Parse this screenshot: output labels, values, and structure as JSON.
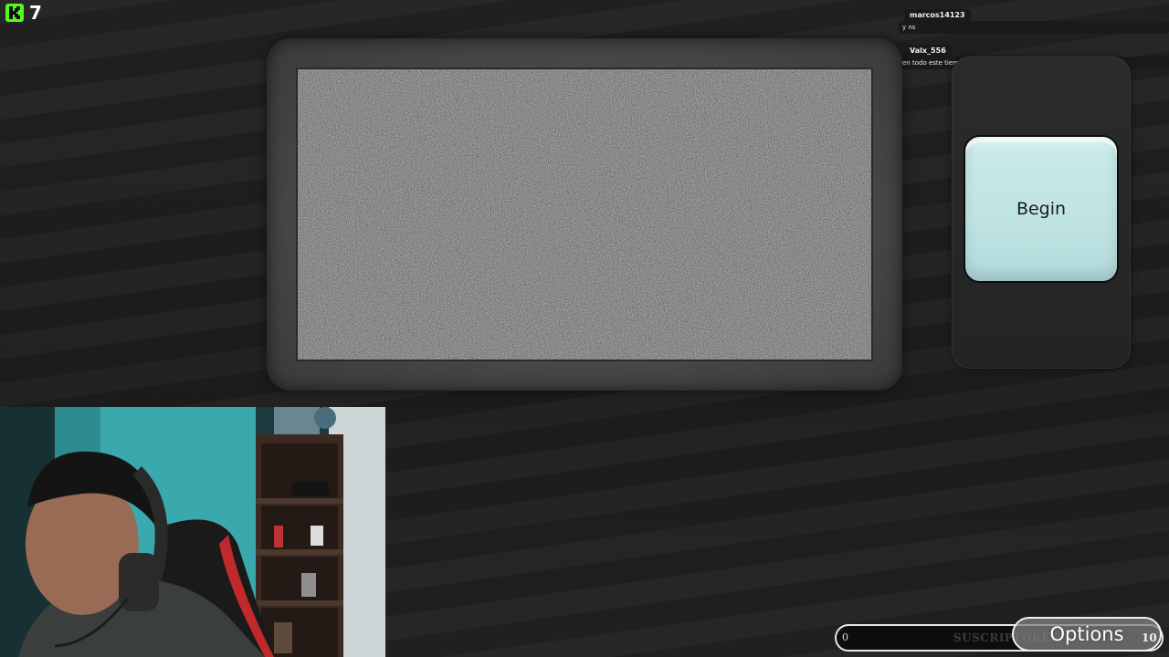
{
  "stream_overlay": {
    "platform_icon": "kick-logo-icon",
    "viewer_count": "7"
  },
  "chat": {
    "messages": [
      {
        "user": "marcos14123",
        "text": "y ns"
      },
      {
        "user": "Valx_556",
        "text": "en todo este tiempo estuve viendo otro steamer"
      }
    ]
  },
  "game": {
    "screen_state": "static-noise",
    "begin_label": "Begin",
    "options_label": "Options",
    "accent_color": "#bfe3e3"
  },
  "subscriber_goal": {
    "start": "0",
    "label": "SUSCRIPTORES",
    "goal": "10"
  },
  "webcam": {
    "icon": "webcam-feed"
  }
}
